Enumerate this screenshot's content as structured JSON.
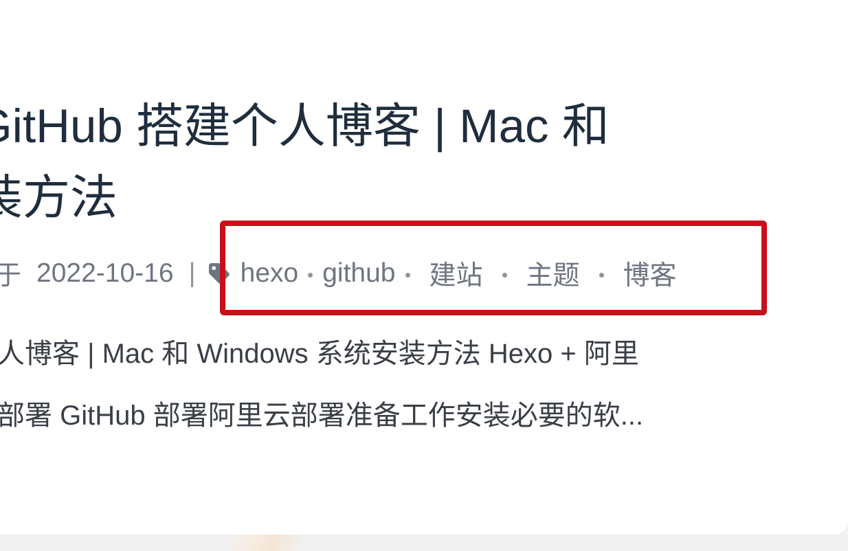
{
  "post": {
    "title": "GitHub 搭建个人博客 | Mac 和\n装方法",
    "meta": {
      "posted_label": "斩于",
      "date": "2022-10-16",
      "separator": "|",
      "tag_icon": "tag-icon",
      "tags": [
        "hexo",
        "github",
        "建站",
        "主题",
        "博客"
      ]
    },
    "excerpt": "个人博客 | Mac 和 Windows 系统安装方法 Hexo + 阿里\n地部署 GitHub 部署阿里云部署准备工作安装必要的软..."
  },
  "colors": {
    "highlight": "#c8101a",
    "title": "#1f2d3d",
    "meta": "#6f7580",
    "excerpt": "#3a3f46"
  }
}
